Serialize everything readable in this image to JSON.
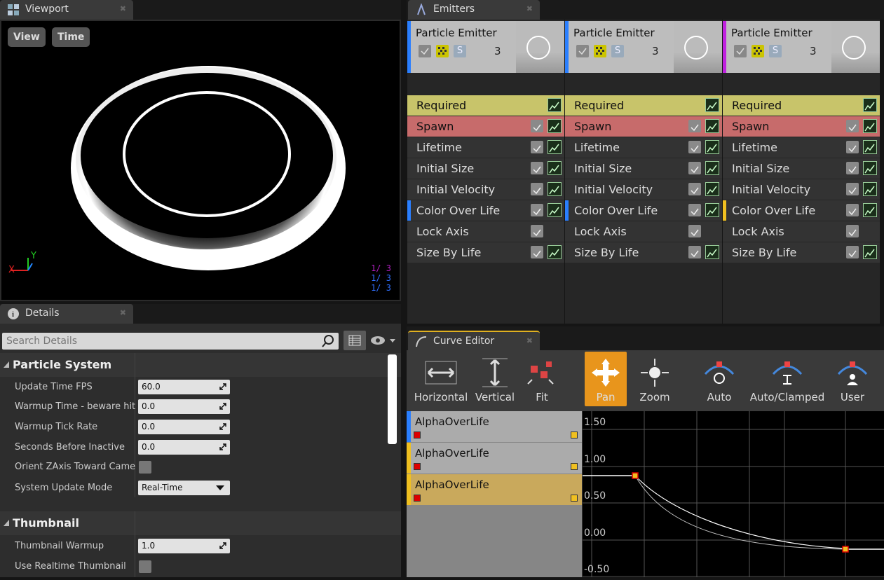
{
  "viewport": {
    "tab_title": "Viewport",
    "view_btn": "View",
    "time_btn": "Time",
    "axis_x": "X",
    "axis_y": "Y",
    "stats": [
      [
        "1/",
        "3"
      ],
      [
        "1/",
        "3"
      ],
      [
        "1/",
        "3"
      ]
    ],
    "stat_colors": [
      "#b020c0",
      "#3070ff",
      "#3070ff"
    ]
  },
  "details": {
    "tab_title": "Details",
    "search_placeholder": "Search Details",
    "categories": [
      {
        "label": "Particle System"
      },
      {
        "label": "Thumbnail"
      }
    ],
    "props": [
      {
        "label": "Update Time FPS",
        "value": "60.0"
      },
      {
        "label": "Warmup Time - beware hitches!",
        "value": "0.0"
      },
      {
        "label": "Warmup Tick Rate",
        "value": "0.0"
      },
      {
        "label": "Seconds Before Inactive",
        "value": "0.0"
      },
      {
        "label": "Orient ZAxis Toward Camera",
        "value": ""
      },
      {
        "label": "System Update Mode",
        "value": "Real-Time"
      },
      {
        "label": "Thumbnail Warmup",
        "value": "1.0"
      },
      {
        "label": "Use Realtime Thumbnail",
        "value": ""
      }
    ]
  },
  "emitters": {
    "tab_title": "Emitters",
    "columns": [
      {
        "name": "Particle Emitter",
        "count": "3",
        "color": "#2a7fff",
        "mark": "#2a7fff"
      },
      {
        "name": "Particle Emitter",
        "count": "3",
        "color": "#2a7fff",
        "mark": "#2a7fff"
      },
      {
        "name": "Particle Emitter",
        "count": "3",
        "color": "#c020e0",
        "mark": "#f0c020"
      }
    ],
    "modules": [
      "Required",
      "Spawn",
      "Lifetime",
      "Initial Size",
      "Initial Velocity",
      "Color Over Life",
      "Lock Axis",
      "Size By Life"
    ]
  },
  "curve_editor": {
    "tab_title": "Curve Editor",
    "tools": [
      "Horizontal",
      "Vertical",
      "Fit",
      "Pan",
      "Zoom",
      "Auto",
      "Auto/Clamped",
      "User"
    ],
    "curves": [
      {
        "label": "AlphaOverLife",
        "color": "#2a7fff"
      },
      {
        "label": "AlphaOverLife",
        "color": "#f0c020"
      },
      {
        "label": "AlphaOverLife",
        "color": "#f0c020"
      }
    ],
    "y_labels": [
      "1.50",
      "1.00",
      "0.50",
      "0.00",
      "-0.50"
    ]
  }
}
